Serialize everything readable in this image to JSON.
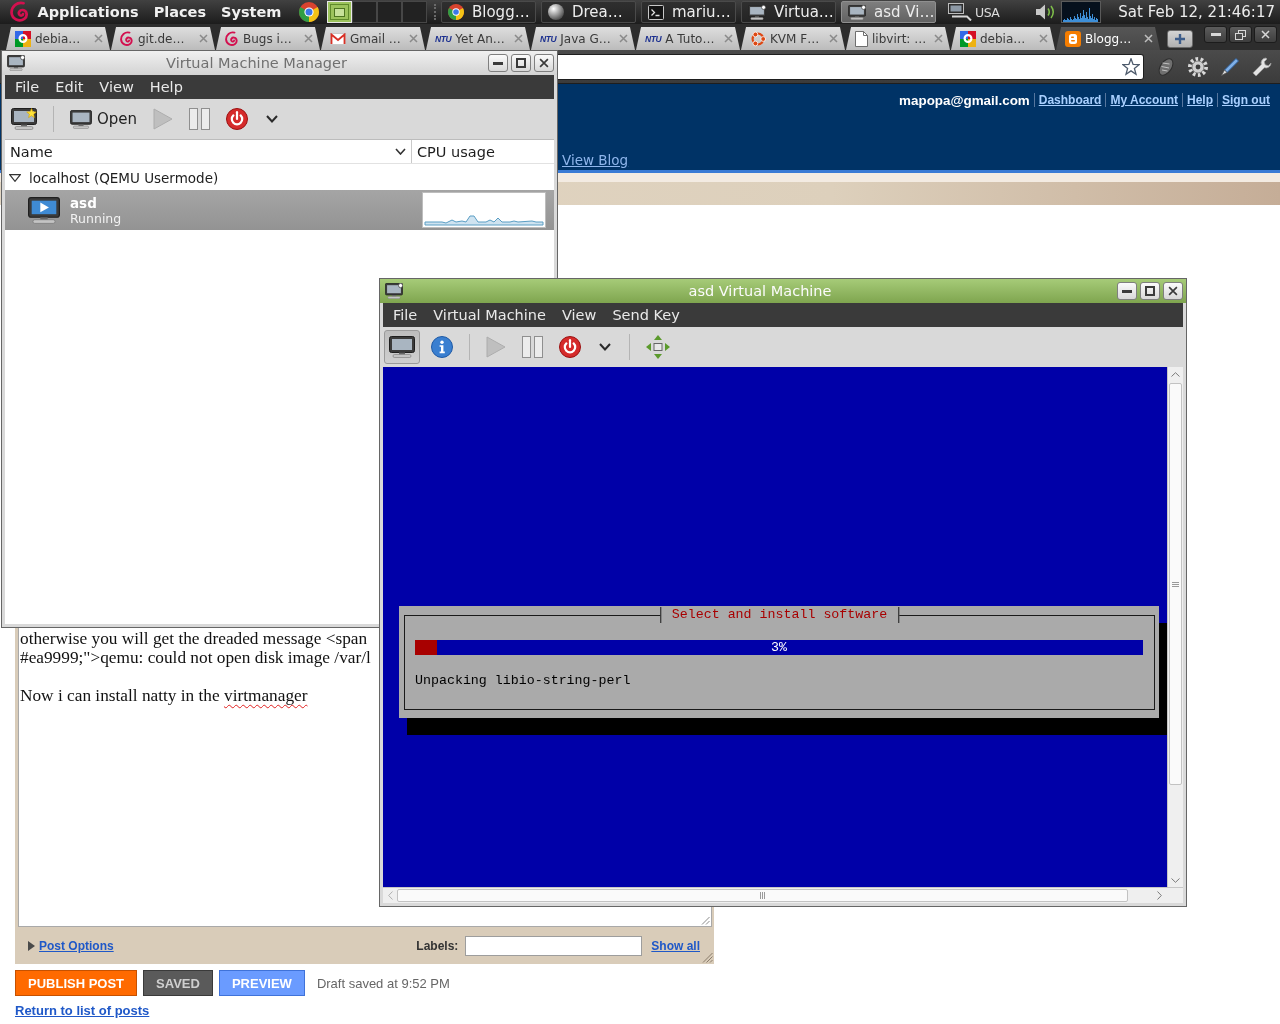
{
  "top_panel": {
    "menus": [
      "Applications",
      "Places",
      "System"
    ],
    "workspaces": [
      {
        "selected": true
      },
      {
        "selected": false
      },
      {
        "selected": false
      },
      {
        "selected": false
      }
    ],
    "tasks": [
      {
        "label": "Blogg…",
        "kind": "circle-logo",
        "selected": false
      },
      {
        "label": "Drea…",
        "kind": "sphere",
        "selected": false
      },
      {
        "label": "mariu…",
        "kind": "terminal",
        "selected": false
      },
      {
        "label": "Virtua…",
        "kind": "monitor",
        "selected": false
      },
      {
        "label": "asd Vi…",
        "kind": "monitor",
        "selected": true
      }
    ],
    "keyboard_layout": "USA",
    "clock": "Sat Feb 12, 21:46:17"
  },
  "browser": {
    "tabs": [
      {
        "label": "debia…",
        "kind": "quad",
        "selected": false
      },
      {
        "label": "git.de…",
        "kind": "swirl",
        "selected": false
      },
      {
        "label": "Bugs i…",
        "kind": "swirl",
        "selected": false
      },
      {
        "label": "Gmail …",
        "kind": "envelope",
        "selected": false
      },
      {
        "label": "Yet An…",
        "kind": "text-logo",
        "logo": "NTU",
        "selected": false
      },
      {
        "label": "Java G…",
        "kind": "text-logo",
        "logo": "NTU",
        "selected": false
      },
      {
        "label": "A Tuto…",
        "kind": "text-logo",
        "logo": "NTU",
        "selected": false
      },
      {
        "label": "KVM F…",
        "kind": "ring",
        "selected": false
      },
      {
        "label": "libvirt: …",
        "kind": "page",
        "selected": false
      },
      {
        "label": "debia…",
        "kind": "quad",
        "selected": false
      },
      {
        "label": "Blogg…",
        "kind": "tile",
        "selected": true
      }
    ],
    "page": {
      "account": {
        "user": "mapopa@gmail.com",
        "links": [
          "Dashboard",
          "My Account",
          "Help",
          "Sign out"
        ]
      },
      "view_blog": "View Blog",
      "editor": {
        "paragraphs": [
          {
            "lines": [
              [
                {
                  "text": "otherwise you will get the dreaded message <span",
                  "misspelled": false
                }
              ],
              [
                {
                  "text": "#ea9999;\">qemu: could not open disk image /var/l",
                  "misspelled": false
                }
              ]
            ]
          },
          {
            "lines": [
              [
                {
                  "text": "Now i can install natty in the ",
                  "misspelled": false
                },
                {
                  "text": "virtmanager",
                  "misspelled": true
                }
              ]
            ]
          }
        ]
      },
      "post_options": "Post Options",
      "labels": {
        "label": "Labels:",
        "show_all": "Show all"
      },
      "actions": [
        {
          "label": "PUBLISH POST",
          "kind": "publish"
        },
        {
          "label": "SAVED",
          "kind": "saved"
        },
        {
          "label": "PREVIEW",
          "kind": "preview"
        }
      ],
      "draft_status": "Draft saved at 9:52 PM",
      "return_link": "Return to list of posts"
    }
  },
  "manager_window": {
    "title": "Virtual Machine Manager",
    "active": false,
    "menu": [
      "File",
      "Edit",
      "View",
      "Help"
    ],
    "toolbar": [
      [
        {
          "kind": "new",
          "disabled": false
        }
      ],
      [
        {
          "kind": "open",
          "label": "Open",
          "disabled": false
        },
        {
          "kind": "run",
          "disabled": true
        },
        {
          "kind": "pause",
          "disabled": false
        },
        {
          "kind": "shutdown",
          "disabled": false
        },
        {
          "kind": "menu",
          "disabled": false
        }
      ]
    ],
    "columns": [
      {
        "label": "Name",
        "sorted": true
      },
      {
        "label": "CPU usage",
        "sorted": false
      }
    ],
    "hosts": [
      {
        "name": "localhost (QEMU Usermode)",
        "expanded": true,
        "children": [
          {
            "name": "asd",
            "status": "Running",
            "selected": true
          }
        ]
      }
    ]
  },
  "vm_window": {
    "title": "asd Virtual Machine",
    "active": true,
    "menu": [
      "File",
      "Virtual Machine",
      "View",
      "Send Key"
    ],
    "toolbar": [
      [
        {
          "kind": "console",
          "pressed": true,
          "disabled": false
        },
        {
          "kind": "details",
          "pressed": false,
          "disabled": false
        }
      ],
      [
        {
          "kind": "run",
          "pressed": false,
          "disabled": true
        },
        {
          "kind": "pause",
          "pressed": false,
          "disabled": false
        },
        {
          "kind": "shutdown",
          "pressed": false,
          "disabled": false
        },
        {
          "kind": "menu",
          "pressed": false,
          "disabled": false
        }
      ],
      [
        {
          "kind": "fullscreen",
          "pressed": false,
          "disabled": false
        }
      ]
    ],
    "console": {
      "dialog_title": "Select and install software",
      "progress": {
        "level": 0.03,
        "reading": "3%"
      },
      "message": "Unpacking libio-string-perl"
    }
  }
}
